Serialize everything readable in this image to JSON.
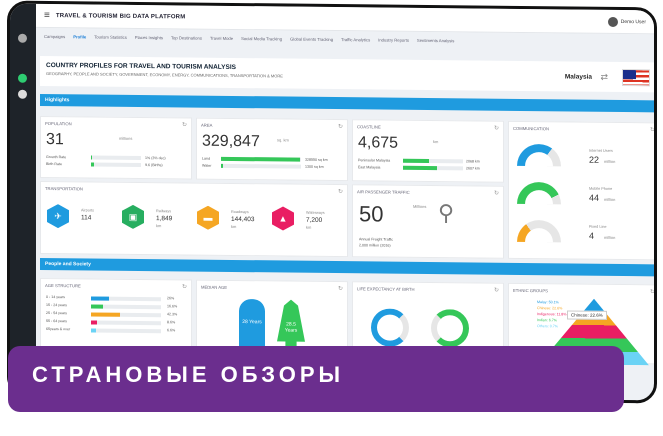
{
  "app": {
    "title": "TRAVEL & TOURISM BIG DATA PLATFORM",
    "user": "Demo User"
  },
  "tabs": [
    "Campaigns",
    "Profile",
    "Tourism Statistics",
    "Places Insights",
    "Top Destinations",
    "Travel Mode",
    "Social Media Tracking",
    "Global Events Tracking",
    "Traffic Analytics",
    "Industry Reports",
    "Sentiments Analysis"
  ],
  "header": {
    "title": "COUNTRY PROFILES FOR TRAVEL AND TOURISM ANALYSIS",
    "subtitle": "GEOGRAPHY, PEOPLE AND SOCIETY, GOVERNMENT, ECONOMY, ENERGY, COMMUNICATIONS, TRANSPORTATION & MORE",
    "country": "Malaysia"
  },
  "highlights": {
    "label": "Highlights"
  },
  "population": {
    "title": "POPULATION",
    "value": "31",
    "unit": "millions",
    "rows": [
      {
        "label": "Growth Rate",
        "value": "1% (3% dec)",
        "pct": 0.02
      },
      {
        "label": "Birth Rate",
        "value": "9.6 (Births)",
        "pct": 0.05
      }
    ]
  },
  "area": {
    "title": "AREA",
    "value": "329,847",
    "unit": "sq. km",
    "rows": [
      {
        "label": "Land",
        "value": "328550 sq km",
        "pct": 0.99
      },
      {
        "label": "Water",
        "value": "1300 sq km",
        "pct": 0.02
      }
    ]
  },
  "coastline": {
    "title": "COASTLINE",
    "value": "4,675",
    "unit": "km",
    "rows": [
      {
        "label": "Peninsular Malaysia",
        "value": "2068 km",
        "pct": 0.44
      },
      {
        "label": "East Malaysia",
        "value": "2607 km",
        "pct": 0.56
      }
    ]
  },
  "communication": {
    "title": "COMMUNICATION",
    "items": [
      {
        "label": "Internet Users",
        "value": "22",
        "unit": "million",
        "color": "#1f9bdf",
        "pct": 0.7
      },
      {
        "label": "Mobile Phone",
        "value": "44",
        "unit": "million",
        "color": "#35c759",
        "pct": 0.85
      },
      {
        "label": "Fixed Line",
        "value": "4",
        "unit": "million",
        "color": "#f5a623",
        "pct": 0.3
      }
    ]
  },
  "transportation": {
    "title": "TRANSPORTATION",
    "items": [
      {
        "label": "Airports",
        "value": "114",
        "color": "#1f9bdf",
        "icon": "airplane-icon",
        "glyph": "✈"
      },
      {
        "label": "Railways",
        "value": "1,849",
        "unit": "km",
        "color": "#27ae60",
        "icon": "train-icon",
        "glyph": "▣"
      },
      {
        "label": "Roadways",
        "value": "144,403",
        "unit": "km",
        "color": "#f5a623",
        "icon": "car-icon",
        "glyph": "▬"
      },
      {
        "label": "Waterways",
        "value": "7,200",
        "unit": "km",
        "color": "#e91e63",
        "icon": "ship-icon",
        "glyph": "▲"
      }
    ]
  },
  "air": {
    "title": "AIR PASSENGER TRAFFIC",
    "value": "50",
    "unit": "Millions",
    "foot1": "Annual Freight Traffic",
    "foot2": "2,000 million (2016)"
  },
  "people": {
    "label": "People and Society"
  },
  "age": {
    "title": "AGE STRUCTURE",
    "rows": [
      {
        "label": "0 - 14 years",
        "value": "26%",
        "pct": 0.26,
        "color": "#1f9bdf"
      },
      {
        "label": "15 - 24 years",
        "value": "16.6%",
        "pct": 0.17,
        "color": "#35c759"
      },
      {
        "label": "25 - 54 years",
        "value": "42.3%",
        "pct": 0.42,
        "color": "#f5a623"
      },
      {
        "label": "55 - 64 years",
        "value": "8.6%",
        "pct": 0.09,
        "color": "#e91e63"
      },
      {
        "label": "65years & over",
        "value": "6.6%",
        "pct": 0.07,
        "color": "#6bd3f5"
      }
    ]
  },
  "median": {
    "title": "MEDIAN AGE",
    "male": "28 Years",
    "female": "28.5 Years"
  },
  "life": {
    "title": "LIFE EXPECTANCY AT BIRTH"
  },
  "ethnic": {
    "title": "ETHNIC GROUPS",
    "rows": [
      {
        "label": "Malay: 50.1%",
        "color": "#1f9bdf"
      },
      {
        "label": "Chinese: 22.6%",
        "color": "#f5a623"
      },
      {
        "label": "Indigenous: 11.8%",
        "color": "#e91e63"
      },
      {
        "label": "Indian: 6.7%",
        "color": "#35c759"
      },
      {
        "label": "Others: 0.7%",
        "color": "#6bd3f5"
      }
    ],
    "tooltip": "Chinese: 22.6%"
  },
  "banner": {
    "text": "СТРАНОВЫЕ ОБЗОРЫ"
  }
}
